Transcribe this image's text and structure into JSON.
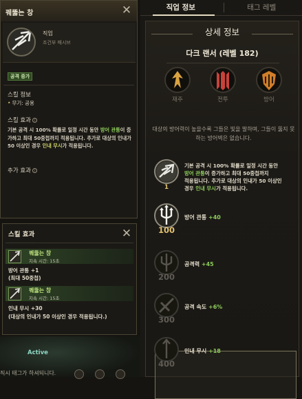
{
  "tabs": {
    "class_info": "직업 정보",
    "tag_level": "태그 레벨"
  },
  "tooltip": {
    "title": "꿰뚫는 창",
    "skill_type": "직업",
    "skill_subtitle": "조건부 패시브",
    "badge": "공격 증가",
    "info_heading": "스킬 정보",
    "weapon_line": "무기: 공용",
    "effect_heading": "스킬 효과",
    "effect_lines": [
      "기본 공격 시 100% 확률로 일정 시간 동안 ",
      "방어 관통",
      "이 증가하고 최대 50중첩까지 적용됩니다. 추가로",
      "대상의 인내가 50 이상인 경우 ",
      "인내 무시",
      "가",
      "적용됩니다."
    ],
    "extra_heading": "추가 효과"
  },
  "buffs": {
    "title": "스킬 효과",
    "items": [
      {
        "name": "꿰뚫는 창",
        "duration": "지속 시간: 15초"
      },
      {
        "name": "꿰뚫는 창",
        "duration": "지속 시간: 15초"
      }
    ],
    "lines": [
      "방어 관통 +1",
      "(최대 50중첩)",
      "인내 무시 +30",
      "(대상의 인내가 50 이상인 경우 적용됩니다.)"
    ]
  },
  "active_label": "Active",
  "bottom_text": "직시 태그가 하셔되니다.",
  "detail": {
    "title": "상세 정보",
    "character": "다크 랜서 (레벨 182)",
    "stats": [
      "재주",
      "전투",
      "방어"
    ],
    "description": "대상의 방어력이 높을수록 그들은 빛을 발하며, 그들이 뚫지 못하는 방어벽은 없습니다.",
    "tier1": {
      "num": "1",
      "lines": [
        "기본 공격 시 100% 확률로 일정 시간 동안",
        "방어 관통",
        "이 증가하고 최대 50중첩까지",
        "적용됩니다. 추가로 대상의 인내가 50 이상인",
        "경우 ",
        "인내 무시",
        "가 적용됩니다."
      ]
    },
    "rows": [
      {
        "num": "100",
        "label": "방어 관통",
        "value": "+40"
      },
      {
        "num": "200",
        "label": "공격력",
        "value": "+45"
      },
      {
        "num": "300",
        "label": "공격 속도",
        "value": "+6%"
      },
      {
        "num": "400",
        "label": "인내 무시",
        "value": "+18"
      }
    ]
  },
  "colors": {
    "accent_green": "#8ccc5a",
    "gold": "#e1c170",
    "highlight_yellow": "#cfd46a"
  }
}
